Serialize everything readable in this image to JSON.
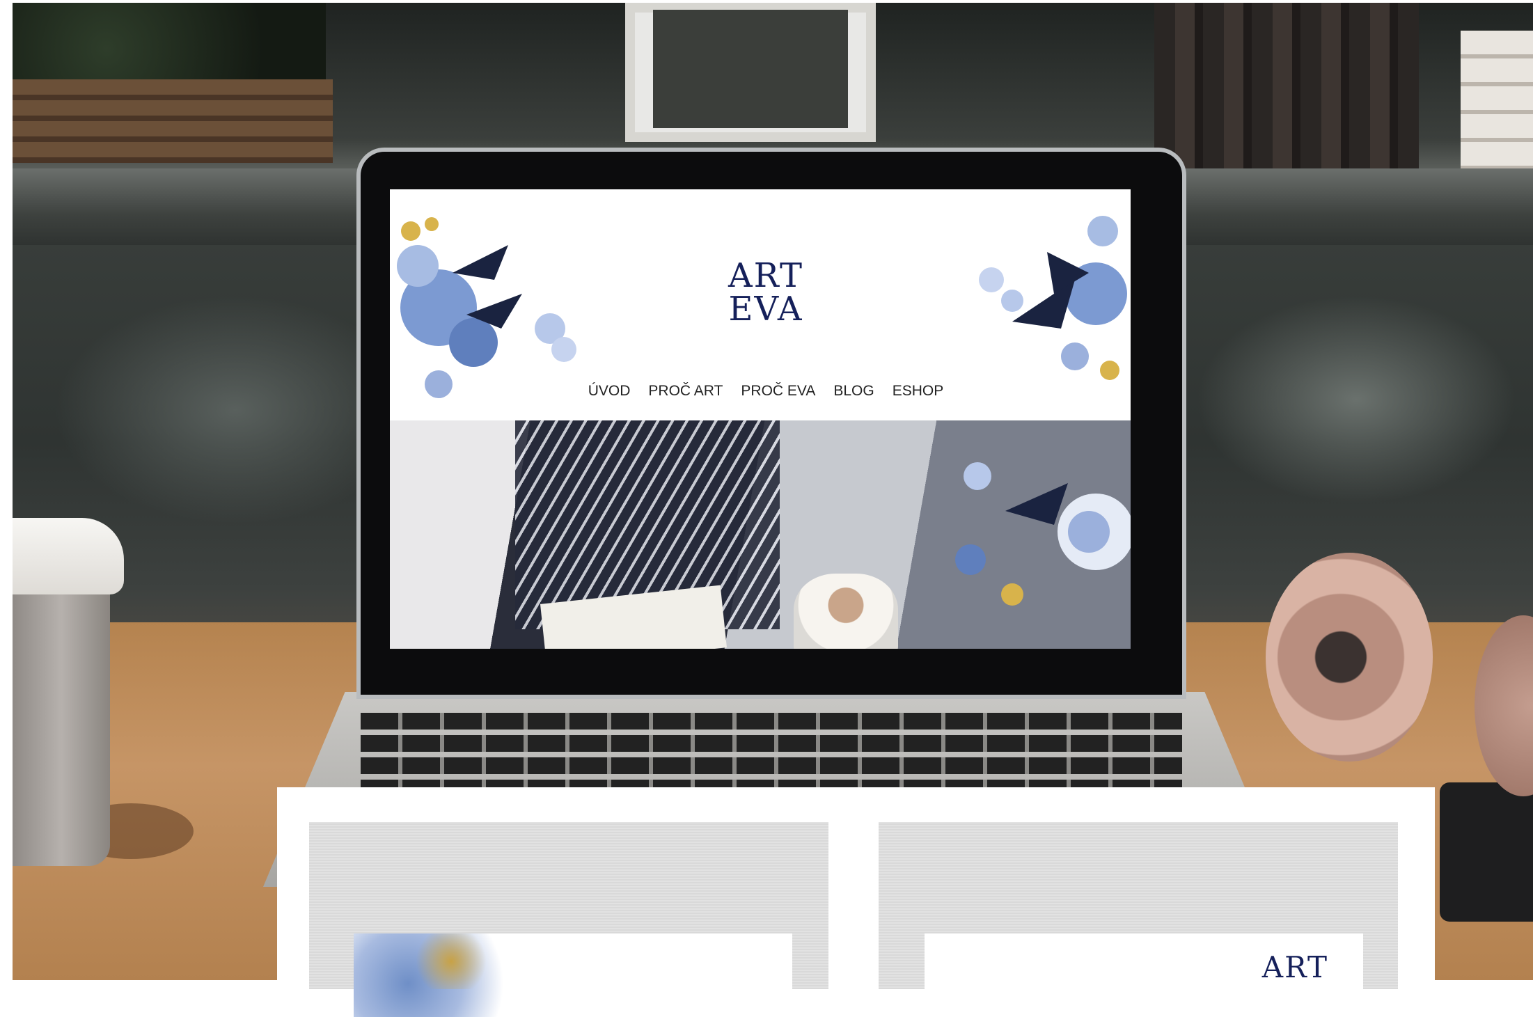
{
  "logo": {
    "line1": "ART",
    "line2": "EVA"
  },
  "nav": {
    "items": [
      {
        "label": "ÚVOD"
      },
      {
        "label": "PROČ ART"
      },
      {
        "label": "PROČ EVA"
      },
      {
        "label": "BLOG"
      },
      {
        "label": "ESHOP"
      }
    ]
  },
  "cards": {
    "right_logo_partial": "ART"
  },
  "colors": {
    "logo_navy": "#15205a",
    "flower_blue": "#6f8fc7",
    "gold_accent": "#c8a246"
  }
}
